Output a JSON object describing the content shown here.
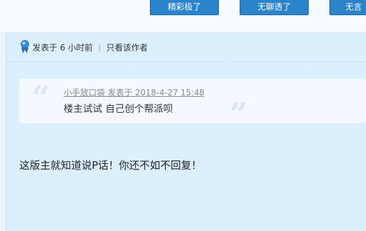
{
  "reactions": {
    "btn1": "精彩极了",
    "btn2": "无聊透了",
    "btn3": "无言"
  },
  "meta": {
    "posted": "发表于 6 小时前",
    "separator": "|",
    "author_only": "只看该作者"
  },
  "quote": {
    "open_mark": "“",
    "close_mark": "”",
    "header": "小手放口袋 发表于 2018-4-27 15:48",
    "text": "楼主试试 自己创个帮派呗"
  },
  "post": {
    "content": "这版主就知道说P话！你还不如不回复！"
  },
  "colors": {
    "button_bg": "#2b83c9",
    "body_bg": "#dceffc"
  }
}
